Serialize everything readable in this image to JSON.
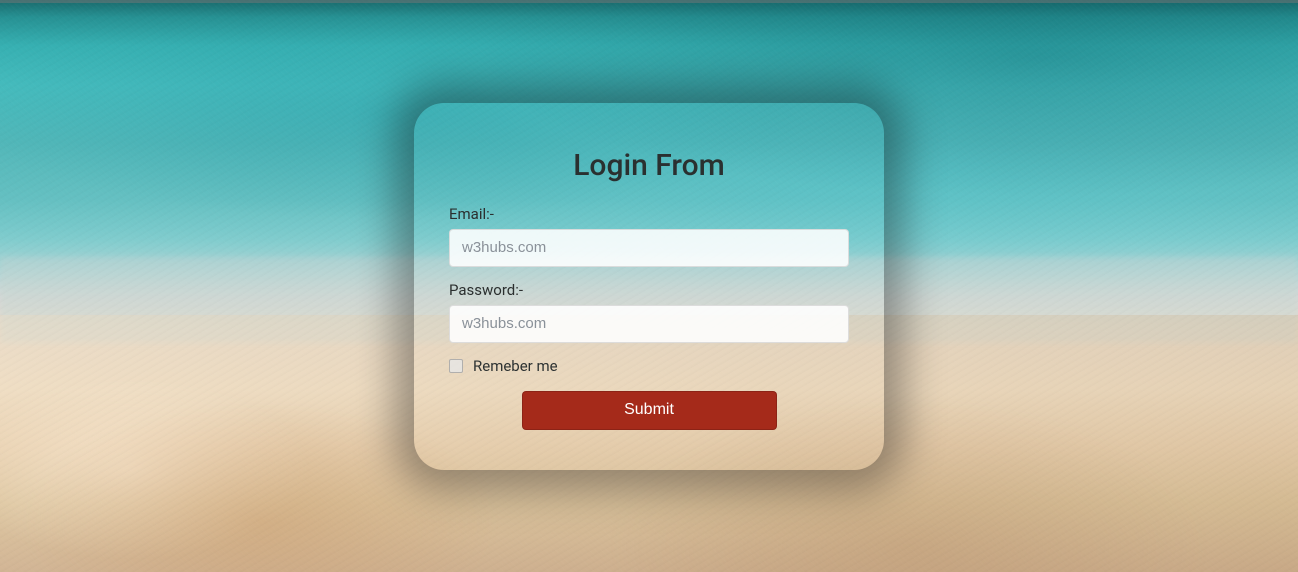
{
  "form": {
    "title": "Login From",
    "email": {
      "label": "Email:-",
      "placeholder": "w3hubs.com",
      "value": ""
    },
    "password": {
      "label": "Password:-",
      "placeholder": "w3hubs.com",
      "value": ""
    },
    "remember": {
      "label": "Remeber me",
      "checked": false
    },
    "submit_label": "Submit"
  },
  "colors": {
    "submit_bg": "#a52a1a",
    "submit_fg": "#ffffff"
  }
}
